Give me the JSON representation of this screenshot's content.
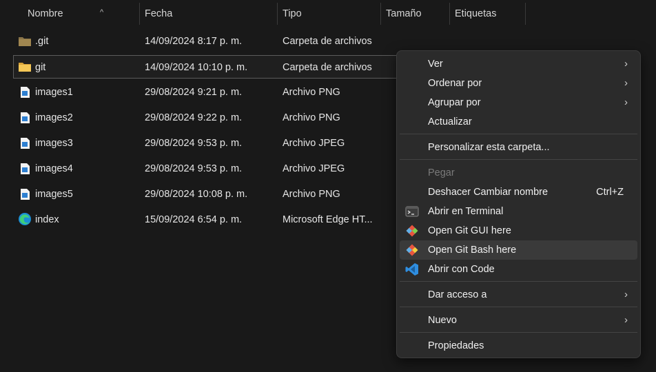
{
  "columns": {
    "name": "Nombre",
    "date": "Fecha",
    "type": "Tipo",
    "size": "Tamaño",
    "tags": "Etiquetas"
  },
  "files": [
    {
      "name": ".git",
      "date": "14/09/2024 8:17 p. m.",
      "type": "Carpeta de archivos",
      "icon": "folder-dim-icon"
    },
    {
      "name": "git",
      "date": "14/09/2024 10:10 p. m.",
      "type": "Carpeta de archivos",
      "icon": "folder-icon"
    },
    {
      "name": "images1",
      "date": "29/08/2024 9:21 p. m.",
      "type": "Archivo PNG",
      "icon": "image-file-icon"
    },
    {
      "name": "images2",
      "date": "29/08/2024 9:22 p. m.",
      "type": "Archivo PNG",
      "icon": "image-file-icon"
    },
    {
      "name": "images3",
      "date": "29/08/2024 9:53 p. m.",
      "type": "Archivo JPEG",
      "icon": "image-file-icon"
    },
    {
      "name": "images4",
      "date": "29/08/2024 9:53 p. m.",
      "type": "Archivo JPEG",
      "icon": "image-file-icon"
    },
    {
      "name": "images5",
      "date": "29/08/2024 10:08 p. m.",
      "type": "Archivo PNG",
      "icon": "image-file-icon"
    },
    {
      "name": "index",
      "date": "15/09/2024 6:54 p. m.",
      "type": "Microsoft Edge HT...",
      "icon": "edge-icon"
    }
  ],
  "menu": {
    "ver": "Ver",
    "ordenar": "Ordenar por",
    "agrupar": "Agrupar por",
    "actualizar": "Actualizar",
    "personalizar": "Personalizar esta carpeta...",
    "pegar": "Pegar",
    "deshacer": "Deshacer Cambiar nombre",
    "deshacer_shortcut": "Ctrl+Z",
    "terminal": "Abrir en Terminal",
    "git_gui": "Open Git GUI here",
    "git_bash": "Open Git Bash here",
    "code": "Abrir con Code",
    "dar_acceso": "Dar acceso a",
    "nuevo": "Nuevo",
    "propiedades": "Propiedades"
  },
  "colors": {
    "background": "#191919",
    "menu_bg": "#2b2b2b",
    "folder": "#e8b84a",
    "vscode": "#2f8ee0",
    "git": "#e8553f"
  }
}
